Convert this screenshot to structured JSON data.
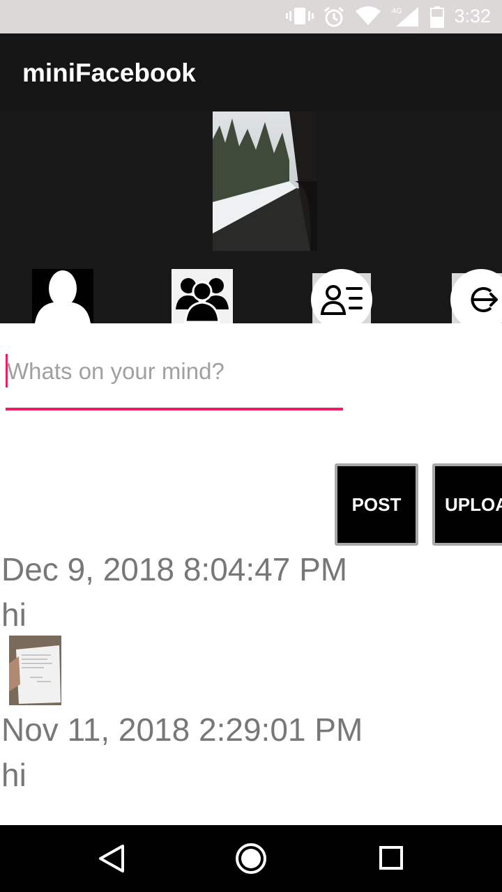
{
  "status_bar": {
    "time": "3:32",
    "network": "4G",
    "icons": [
      "vibrate-icon",
      "alarm-icon",
      "wifi-icon",
      "signal-icon",
      "battery-icon"
    ]
  },
  "app_bar": {
    "title": "miniFacebook"
  },
  "header": {
    "nav_icons": [
      "profile-icon",
      "friends-icon",
      "contacts-list-icon",
      "logout-icon"
    ]
  },
  "composer": {
    "placeholder": "Whats on your mind?",
    "value": ""
  },
  "actions": {
    "post_label": "POST",
    "upload_label": "UPLOA"
  },
  "feed": [
    {
      "date": "Dec 9, 2018 8:04:47 PM",
      "text": "hi",
      "has_image": true
    },
    {
      "date": "Nov 11, 2018 2:29:01 PM",
      "text": "hi",
      "has_image": false
    }
  ],
  "colors": {
    "accent": "#e91e63",
    "appbar": "#151515",
    "header": "#181818"
  }
}
